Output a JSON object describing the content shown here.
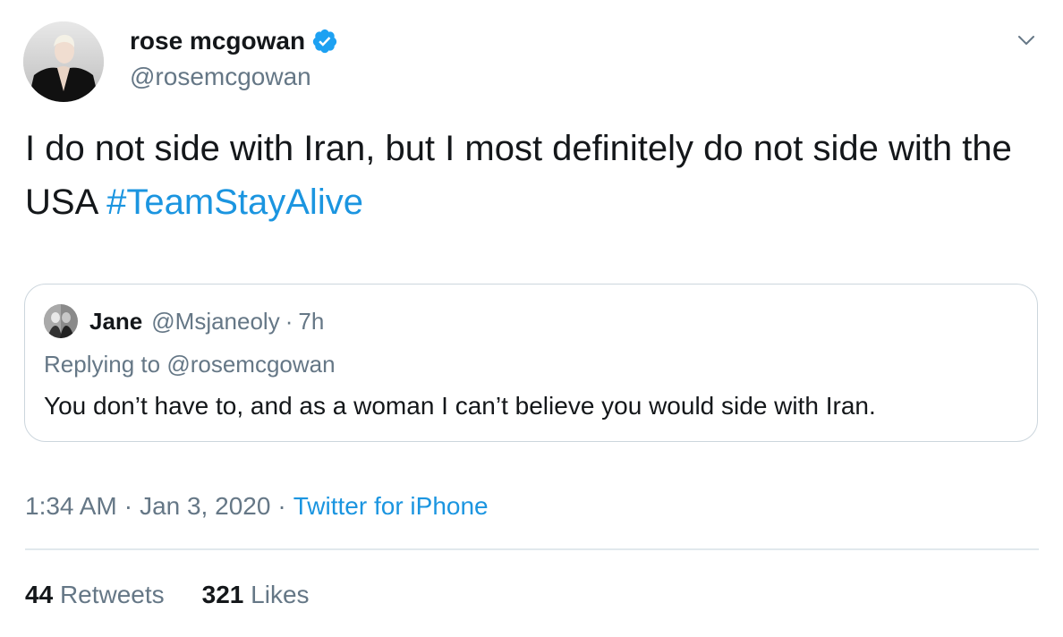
{
  "author": {
    "display_name": "rose mcgowan",
    "handle": "@rosemcgowan",
    "verified": true,
    "avatar_icon": "profile-photo"
  },
  "tweet": {
    "text": "I do not side with Iran, but I most definitely do not side with the USA ",
    "hashtag": "#TeamStayAlive"
  },
  "quoted_tweet": {
    "display_name": "Jane",
    "handle": "@Msjaneoly",
    "separator": "·",
    "time": "7h",
    "replying_prefix": "Replying to",
    "replying_to": "@rosemcgowan",
    "text": "You don’t have to, and as a woman I can’t believe you would side with Iran."
  },
  "meta": {
    "time": "1:34 AM",
    "separator": "·",
    "date": "Jan 3, 2020",
    "source": "Twitter for iPhone"
  },
  "stats": {
    "retweets_count": "44",
    "retweets_label": "Retweets",
    "likes_count": "321",
    "likes_label": "Likes"
  },
  "colors": {
    "link": "#1b95e0",
    "secondary_text": "#657786",
    "primary_text": "#14171a",
    "border": "#ccd6dd",
    "verified_badge": "#1da1f2"
  }
}
